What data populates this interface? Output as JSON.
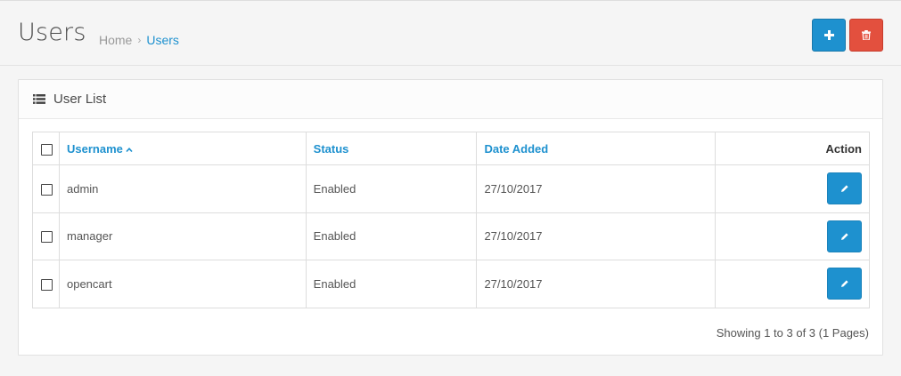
{
  "header": {
    "title": "Users",
    "breadcrumb": [
      {
        "label": "Home"
      },
      {
        "label": "Users"
      }
    ],
    "add_icon": "plus-icon",
    "delete_icon": "trash-icon",
    "add_color": "#1e91cf",
    "delete_color": "#e3503e"
  },
  "panel": {
    "title": "User List",
    "icon": "list-icon"
  },
  "table": {
    "columns": {
      "username": "Username",
      "status": "Status",
      "date_added": "Date Added",
      "action": "Action"
    },
    "sort": {
      "column": "username",
      "direction": "asc"
    },
    "rows": [
      {
        "username": "admin",
        "status": "Enabled",
        "date_added": "27/10/2017"
      },
      {
        "username": "manager",
        "status": "Enabled",
        "date_added": "27/10/2017"
      },
      {
        "username": "opencart",
        "status": "Enabled",
        "date_added": "27/10/2017"
      }
    ]
  },
  "pagination": {
    "summary": "Showing 1 to 3 of 3 (1 Pages)"
  }
}
